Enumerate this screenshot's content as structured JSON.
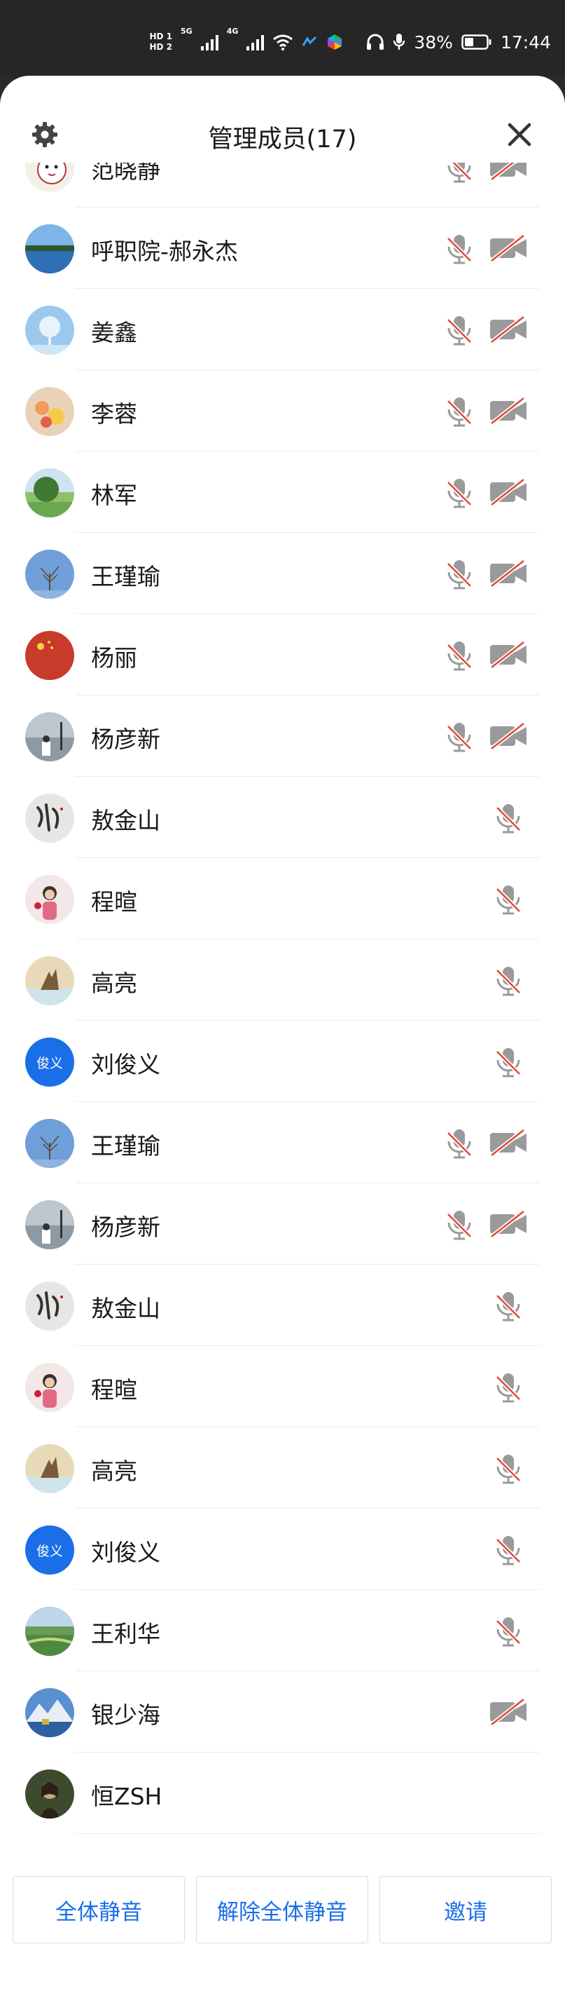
{
  "status_bar": {
    "hd_top": "HD 1",
    "hd_bottom": "HD 2",
    "net1": "5G",
    "net2": "4G",
    "battery": "38%",
    "time": "17:44"
  },
  "header": {
    "title": "管理成员(17)",
    "settings_icon": "gear-icon",
    "close_icon": "close-icon"
  },
  "colors": {
    "accent": "#1a6ee8",
    "muted_icon": "#9a9a9a",
    "mute_slash": "#e0483a"
  },
  "members": [
    {
      "name": "范晓静",
      "mic_muted": true,
      "camera_off": true,
      "avatar": "cartoon"
    },
    {
      "name": "呼职院-郝永杰",
      "mic_muted": true,
      "camera_off": true,
      "avatar": "lake"
    },
    {
      "name": "姜鑫",
      "mic_muted": true,
      "camera_off": true,
      "avatar": "tree-blue"
    },
    {
      "name": "李蓉",
      "mic_muted": true,
      "camera_off": true,
      "avatar": "flowers"
    },
    {
      "name": "林军",
      "mic_muted": true,
      "camera_off": true,
      "avatar": "park"
    },
    {
      "name": "王瑾瑜",
      "mic_muted": true,
      "camera_off": true,
      "avatar": "sky-tree"
    },
    {
      "name": "杨丽",
      "mic_muted": true,
      "camera_off": true,
      "avatar": "red"
    },
    {
      "name": "杨彦新",
      "mic_muted": true,
      "camera_off": true,
      "avatar": "seaside"
    },
    {
      "name": "敖金山",
      "mic_muted": true,
      "camera_off": false,
      "avatar": "calligraphy"
    },
    {
      "name": "程暄",
      "mic_muted": true,
      "camera_off": false,
      "avatar": "child"
    },
    {
      "name": "高亮",
      "mic_muted": true,
      "camera_off": false,
      "avatar": "wolf"
    },
    {
      "name": "刘俊义",
      "mic_muted": true,
      "camera_off": false,
      "avatar_text": "俊义"
    },
    {
      "name": "王瑾瑜",
      "mic_muted": true,
      "camera_off": true,
      "avatar": "sky-tree"
    },
    {
      "name": "杨彦新",
      "mic_muted": true,
      "camera_off": true,
      "avatar": "seaside"
    },
    {
      "name": "敖金山",
      "mic_muted": true,
      "camera_off": false,
      "avatar": "calligraphy"
    },
    {
      "name": "程暄",
      "mic_muted": true,
      "camera_off": false,
      "avatar": "child"
    },
    {
      "name": "高亮",
      "mic_muted": true,
      "camera_off": false,
      "avatar": "wolf"
    },
    {
      "name": "刘俊义",
      "mic_muted": true,
      "camera_off": false,
      "avatar_text": "俊义"
    },
    {
      "name": "王利华",
      "mic_muted": true,
      "camera_off": false,
      "avatar": "field"
    },
    {
      "name": "银少海",
      "mic_muted": false,
      "camera_off": true,
      "avatar": "mountain"
    },
    {
      "name": "恒ZSH",
      "mic_muted": false,
      "camera_off": false,
      "avatar": "portrait"
    }
  ],
  "footer": {
    "mute_all": "全体静音",
    "unmute_all": "解除全体静音",
    "invite": "邀请"
  }
}
